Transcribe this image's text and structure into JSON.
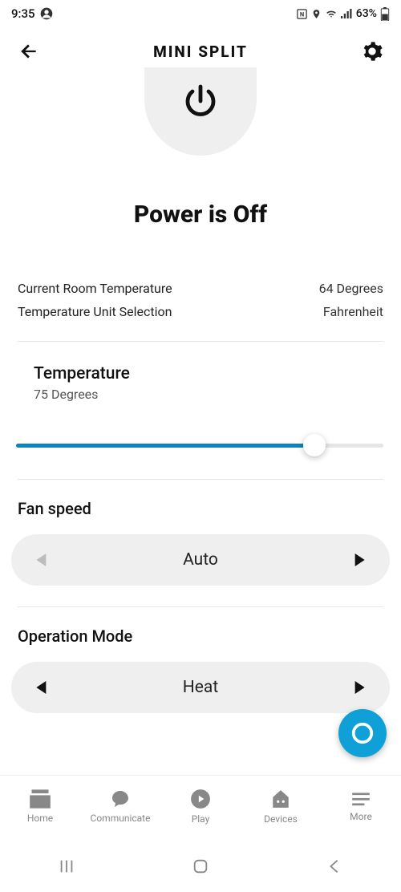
{
  "status_bar": {
    "time": "9:35",
    "battery": "63%"
  },
  "header": {
    "title": "MINI SPLIT"
  },
  "power": {
    "status_text": "Power is Off"
  },
  "info": {
    "room_temp_label": "Current Room Temperature",
    "room_temp_value": "64 Degrees",
    "unit_label": "Temperature Unit Selection",
    "unit_value": "Fahrenheit"
  },
  "temperature": {
    "label": "Temperature",
    "value": "75 Degrees"
  },
  "fan": {
    "label": "Fan speed",
    "value": "Auto"
  },
  "mode": {
    "label": "Operation Mode",
    "value": "Heat"
  },
  "tabs": {
    "home": "Home",
    "communicate": "Communicate",
    "play": "Play",
    "devices": "Devices",
    "more": "More"
  }
}
